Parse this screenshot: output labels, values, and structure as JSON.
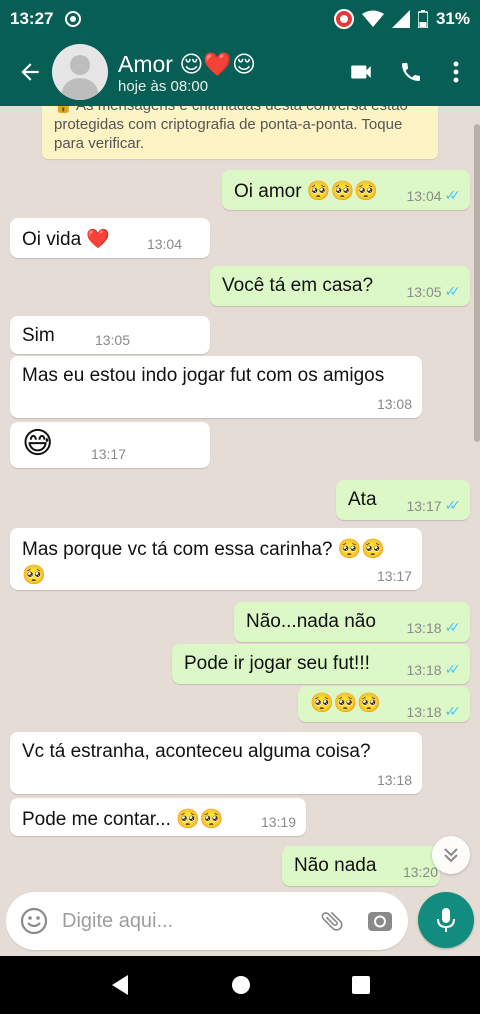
{
  "status_bar": {
    "time": "13:27",
    "battery": "31%"
  },
  "header": {
    "contact_name": "Amor 😌❤️😌",
    "last_seen": "hoje às 08:00"
  },
  "notice": {
    "text": "🔒 As mensagens e chamadas desta conversa estão protegidas com criptografia de ponta-a-ponta. Toque para verificar."
  },
  "messages": [
    {
      "dir": "out",
      "text": "Oi amor 🥺🥺🥺",
      "time": "13:04",
      "read": true
    },
    {
      "dir": "in",
      "text": "Oi vida ❤️",
      "time": "13:04"
    },
    {
      "dir": "out",
      "text": "Você tá em casa?",
      "time": "13:05",
      "read": true
    },
    {
      "dir": "in",
      "text": "Sim",
      "time": "13:05"
    },
    {
      "dir": "in",
      "text": "Mas eu estou indo jogar fut com os amigos",
      "time": "13:08"
    },
    {
      "dir": "in",
      "text": "😅",
      "time": "13:17"
    },
    {
      "dir": "out",
      "text": "Ata",
      "time": "13:17",
      "read": true
    },
    {
      "dir": "in",
      "text": "Mas porque vc tá com essa carinha? 🥺🥺 🥺",
      "time": "13:17"
    },
    {
      "dir": "out",
      "text": "Não...nada não",
      "time": "13:18",
      "read": true
    },
    {
      "dir": "out",
      "text": "Pode ir jogar seu fut!!!",
      "time": "13:18",
      "read": true
    },
    {
      "dir": "out",
      "text": "🥺🥺🥺",
      "time": "13:18",
      "read": true
    },
    {
      "dir": "in",
      "text": "Vc tá estranha, aconteceu alguma coisa?",
      "time": "13:18"
    },
    {
      "dir": "in",
      "text": "Pode me contar... 🥺🥺",
      "time": "13:19"
    },
    {
      "dir": "out",
      "text": "Não nada",
      "time": "13:20"
    }
  ],
  "input": {
    "placeholder": "Digite aqui..."
  },
  "colors": {
    "header": "#075e54",
    "outgoing_bubble": "#dcf8c6",
    "incoming_bubble": "#ffffff",
    "chat_background": "#e5ddd5",
    "read_ticks": "#4fc3f7",
    "mic_button": "#128c7e"
  }
}
